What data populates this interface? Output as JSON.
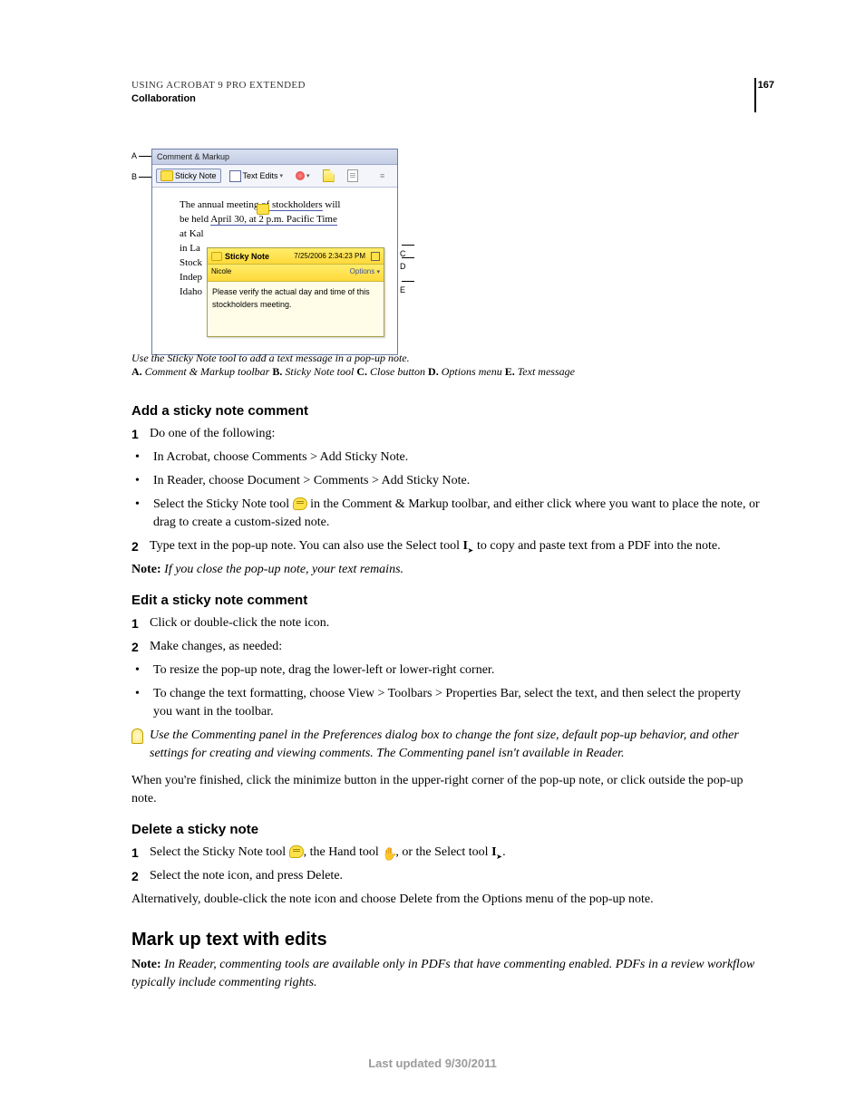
{
  "header": {
    "line1": "USING ACROBAT 9 PRO EXTENDED",
    "line2": "Collaboration",
    "page_number": "167"
  },
  "figure": {
    "window_title": "Comment & Markup",
    "toolbar": {
      "sticky_note": "Sticky Note",
      "text_edits": "Text Edits"
    },
    "doc_lines": {
      "l1a": "The annual meeting ",
      "l1b": "of stockholders",
      "l1c": " will",
      "l2a": "be held ",
      "l2b": "April 30, at 2 p.m. Pacific Time",
      "l3": "at Kal",
      "l4": "in La",
      "l5": "Stock",
      "l6": "Indep",
      "l7": "Idaho"
    },
    "popup": {
      "title": "Sticky Note",
      "timestamp": "7/25/2006 2:34:23 PM",
      "author": "Nicole",
      "options": "Options",
      "body": "Please verify the actual day and time of this stockholders meeting."
    },
    "labels": {
      "A": "A",
      "B": "B",
      "C": "C",
      "D": "D",
      "E": "E"
    }
  },
  "caption": {
    "line1": "Use the Sticky Note tool to add a text message in a pop-up note.",
    "legend_a_label": "A.",
    "legend_a": " Comment & Markup toolbar  ",
    "legend_b_label": "B.",
    "legend_b": " Sticky Note tool  ",
    "legend_c_label": "C.",
    "legend_c": " Close button  ",
    "legend_d_label": "D.",
    "legend_d": " Options menu  ",
    "legend_e_label": "E.",
    "legend_e": " Text message"
  },
  "sections": {
    "add": {
      "heading": "Add a sticky note comment",
      "s1_num": "1",
      "s1": "Do one of the following:",
      "b1": "In Acrobat, choose Comments > Add Sticky Note.",
      "b2": "In Reader, choose Document > Comments > Add Sticky Note.",
      "b3a": "Select the Sticky Note tool ",
      "b3b": " in the Comment & Markup toolbar, and either click where you want to place the note, or drag to create a custom-sized note.",
      "s2_num": "2",
      "s2a": "Type text in the pop-up note. You can also use the Select tool ",
      "s2b": " to copy and paste text from a PDF into the note.",
      "note_label": "Note:",
      "note": " If you close the pop-up note, your text remains."
    },
    "edit": {
      "heading": "Edit a sticky note comment",
      "s1_num": "1",
      "s1": "Click or double-click the note icon.",
      "s2_num": "2",
      "s2": "Make changes, as needed:",
      "b1": "To resize the pop-up note, drag the lower-left or lower-right corner.",
      "b2": "To change the text formatting, choose View > Toolbars > Properties Bar, select the text, and then select the property you want in the toolbar.",
      "tip": "Use the Commenting panel in the Preferences dialog box to change the font size, default pop-up behavior, and other settings for creating and viewing comments. The Commenting panel isn't available in Reader.",
      "para": "When you're finished, click the minimize button in the upper-right corner of the pop-up note, or click outside the pop-up note."
    },
    "delete": {
      "heading": "Delete a sticky note",
      "s1_num": "1",
      "s1a": "Select the Sticky Note tool ",
      "s1b": ", the Hand tool ",
      "s1c": ", or the Select tool ",
      "s1d": ".",
      "s2_num": "2",
      "s2": "Select the note icon, and press Delete.",
      "para": "Alternatively, double-click the note icon and choose Delete from the Options menu of the pop-up note."
    },
    "markup": {
      "heading": "Mark up text with edits",
      "note_label": "Note:",
      "note": " In Reader, commenting tools are available only in PDFs that have commenting enabled. PDFs in a review workflow typically include commenting rights."
    }
  },
  "footer": "Last updated 9/30/2011"
}
